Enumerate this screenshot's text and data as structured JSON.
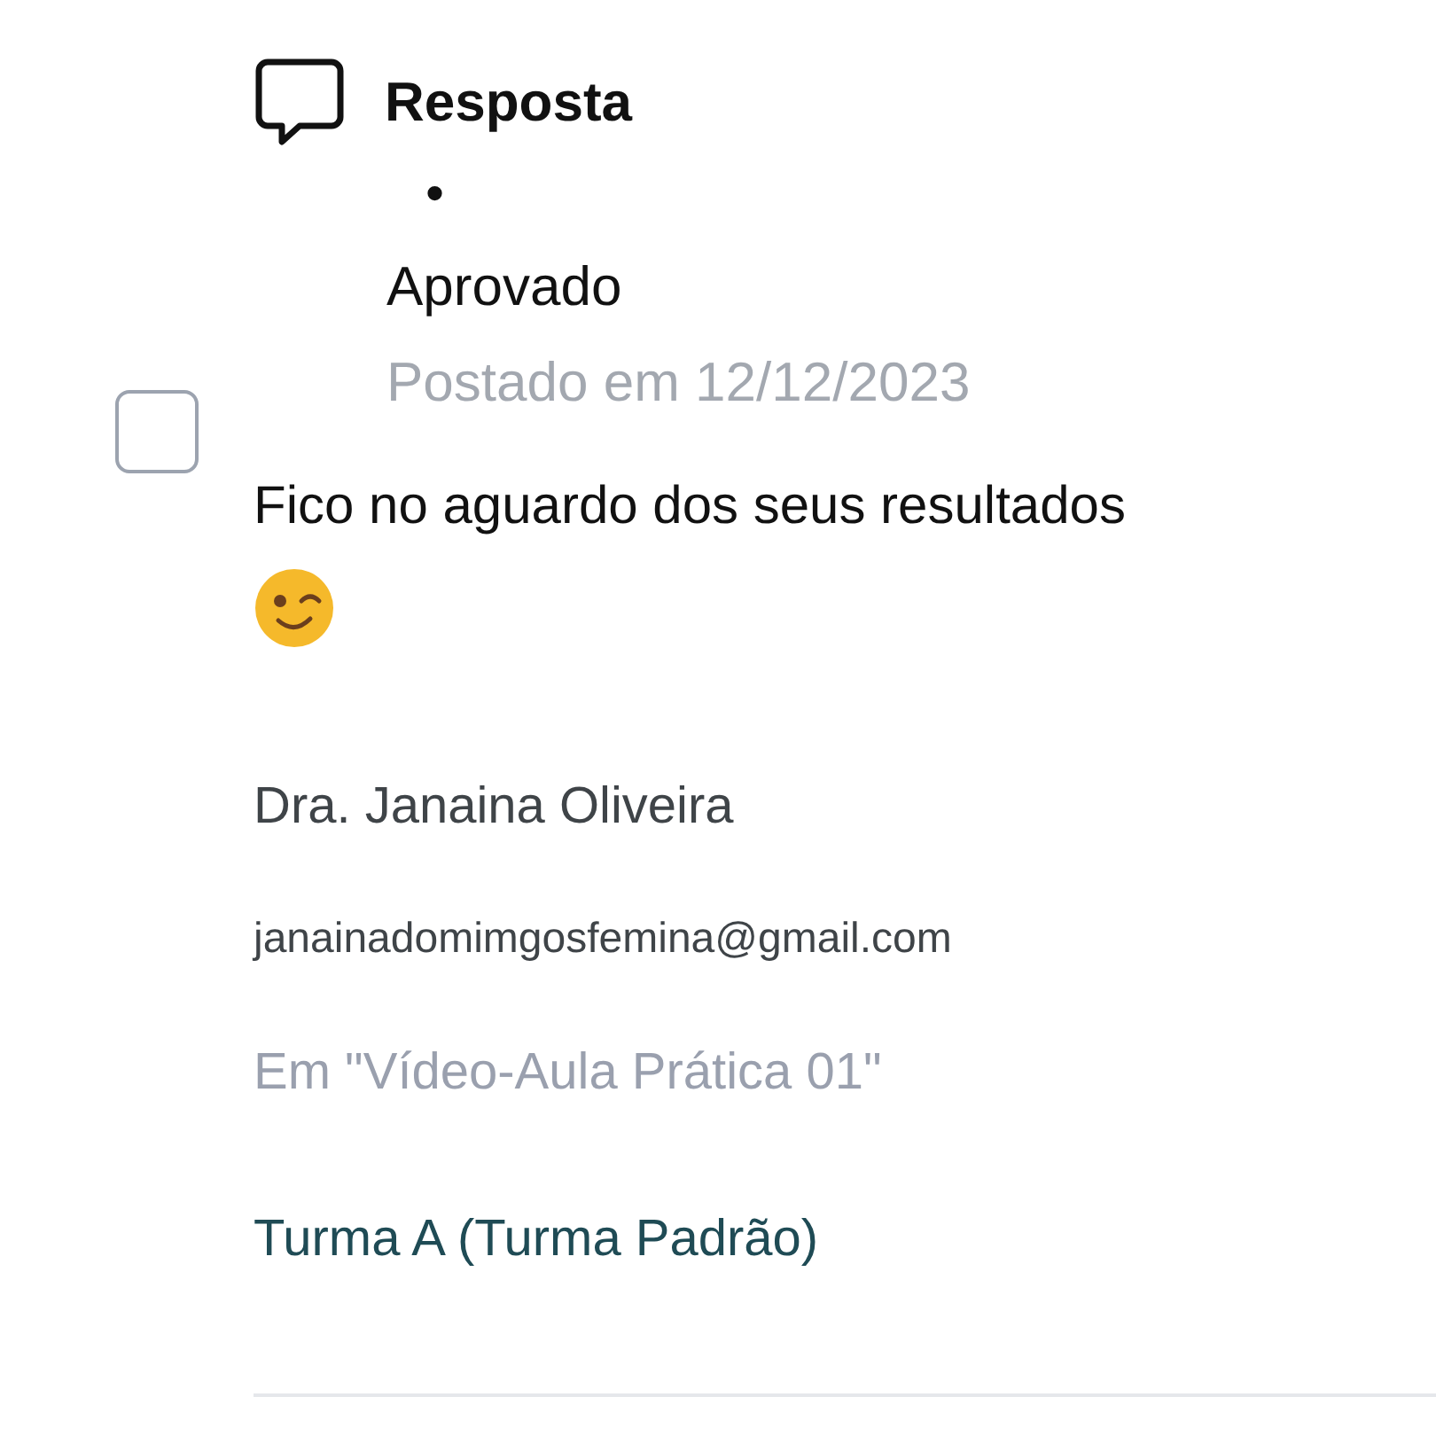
{
  "checkbox": {
    "checked": false
  },
  "header": {
    "title": "Resposta"
  },
  "status": {
    "bullet": "•",
    "label": "Aprovado"
  },
  "posted": "Postado em 12/12/2023",
  "message": {
    "text": "Fico no aguardo dos seus resultados",
    "emoji": {
      "kind": "wink"
    }
  },
  "author": {
    "name": "Dra. Janaina Oliveira",
    "email": "janainadomimgosfemina@gmail.com"
  },
  "context": "Em \"Vídeo-Aula Prática 01\"",
  "class_link": "Turma A (Turma Padrão)"
}
